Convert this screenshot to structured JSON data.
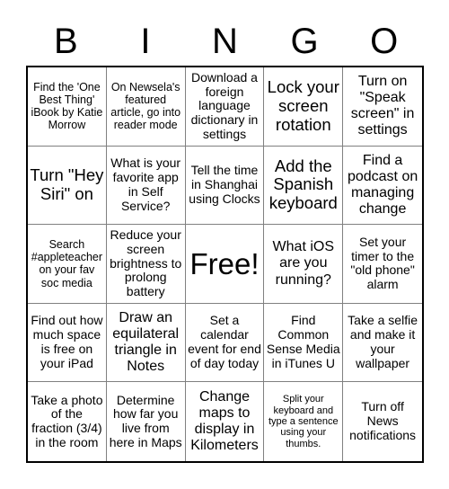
{
  "header": {
    "letters": [
      "B",
      "I",
      "N",
      "G",
      "O"
    ]
  },
  "grid": {
    "rows": 5,
    "columns": 5,
    "free_space_index": 12,
    "cells": [
      {
        "text": "Find the 'One Best Thing' iBook by Katie Morrow",
        "size": "sm"
      },
      {
        "text": "On Newsela's featured article, go into reader mode",
        "size": "sm"
      },
      {
        "text": "Download a foreign language dictionary in settings",
        "size": "md"
      },
      {
        "text": "Lock your screen rotation",
        "size": "xl"
      },
      {
        "text": "Turn on \"Speak screen\" in settings",
        "size": "lg"
      },
      {
        "text": "Turn \"Hey Siri\" on",
        "size": "xl"
      },
      {
        "text": "What is your favorite app in Self Service?",
        "size": "md"
      },
      {
        "text": "Tell the time in Shanghai using Clocks",
        "size": "md"
      },
      {
        "text": "Add the Spanish keyboard",
        "size": "xl"
      },
      {
        "text": "Find a podcast on managing change",
        "size": "lg"
      },
      {
        "text": "Search #appleteacher on your fav soc media",
        "size": "sm"
      },
      {
        "text": "Reduce your screen brightness to prolong battery",
        "size": "md"
      },
      {
        "text": "Free!",
        "size": "free"
      },
      {
        "text": "What iOS are you running?",
        "size": "lg"
      },
      {
        "text": "Set your timer to the \"old phone\" alarm",
        "size": "md"
      },
      {
        "text": "Find out how much space is free on your iPad",
        "size": "md"
      },
      {
        "text": "Draw an equilateral triangle in Notes",
        "size": "lg"
      },
      {
        "text": "Set a calendar event for end of day today",
        "size": "md"
      },
      {
        "text": "Find Common Sense Media in iTunes U",
        "size": "md"
      },
      {
        "text": "Take a selfie and make it your wallpaper",
        "size": "md"
      },
      {
        "text": "Take a photo of the fraction (3/4) in the room",
        "size": "md"
      },
      {
        "text": "Determine how far you live from here in Maps",
        "size": "md"
      },
      {
        "text": "Change maps to display in Kilometers",
        "size": "lg"
      },
      {
        "text": "Split your keyboard and type a sentence using your thumbs.",
        "size": "xs"
      },
      {
        "text": "Turn off News notifications",
        "size": "md"
      }
    ]
  }
}
